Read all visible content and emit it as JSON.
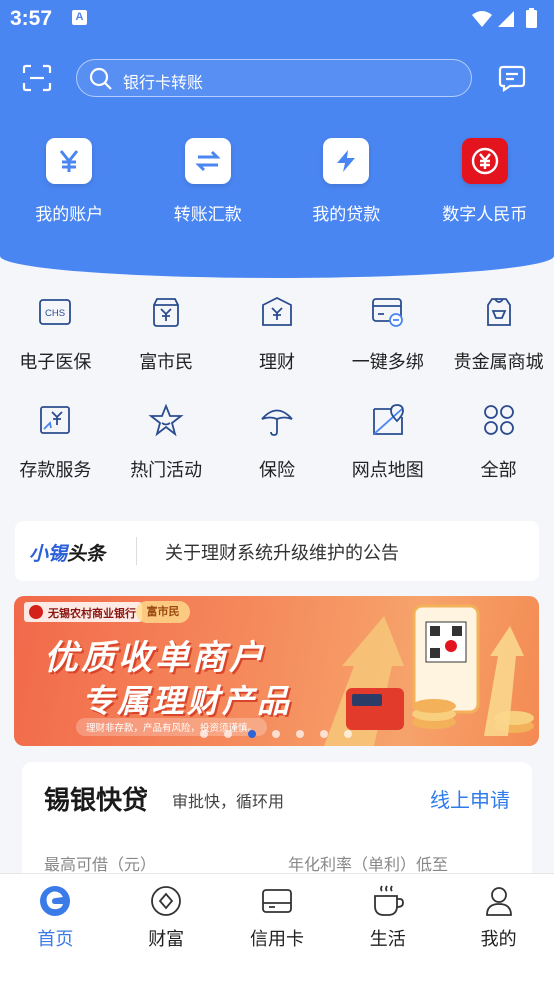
{
  "status_bar": {
    "time": "3:57",
    "notification_badge": "A"
  },
  "search": {
    "placeholder": "银行卡转账"
  },
  "quick_actions": [
    {
      "label": "我的账户",
      "icon": "yen-icon"
    },
    {
      "label": "转账汇款",
      "icon": "transfer-arrows-icon"
    },
    {
      "label": "我的贷款",
      "icon": "lightning-icon"
    },
    {
      "label": "数字人民币",
      "icon": "digital-rmb-icon"
    }
  ],
  "services": [
    {
      "label": "电子医保",
      "icon": "medical-insurance-icon",
      "icon_text": "CHS"
    },
    {
      "label": "富市民",
      "icon": "wallet-yen-icon"
    },
    {
      "label": "理财",
      "icon": "wealth-box-icon"
    },
    {
      "label": "一键多绑",
      "icon": "card-link-icon"
    },
    {
      "label": "贵金属商城",
      "icon": "gold-bag-icon"
    },
    {
      "label": "存款服务",
      "icon": "deposit-icon"
    },
    {
      "label": "热门活动",
      "icon": "star-icon"
    },
    {
      "label": "保险",
      "icon": "umbrella-icon"
    },
    {
      "label": "网点地图",
      "icon": "map-pin-icon"
    },
    {
      "label": "全部",
      "icon": "grid-circles-icon"
    }
  ],
  "headline": {
    "brand_part1": "小锡",
    "brand_part2": "头条",
    "text": "关于理财系统升级维护的公告"
  },
  "banner": {
    "bank_name": "无锡农村商业银行",
    "partner_badge": "富市民",
    "headline1": "优质收单商户",
    "headline2": "专属理财产品",
    "disclaimer": "理财非存款，产品有风险，投资须谨慎。",
    "slide_count": 7,
    "active_slide": 3
  },
  "loan_card": {
    "title": "锡银快贷",
    "subtitle": "审批快，循环用",
    "apply_label": "线上申请",
    "max_label": "最高可借（元）",
    "rate_label": "年化利率（单利）低至"
  },
  "tabs": [
    {
      "label": "首页",
      "icon": "home-logo-icon",
      "active": true
    },
    {
      "label": "财富",
      "icon": "wealth-icon",
      "active": false
    },
    {
      "label": "信用卡",
      "icon": "credit-card-icon",
      "active": false
    },
    {
      "label": "生活",
      "icon": "coffee-cup-icon",
      "active": false
    },
    {
      "label": "我的",
      "icon": "user-icon",
      "active": false
    }
  ],
  "colors": {
    "primary": "#4a86f2",
    "accent_blue": "#2f7bea",
    "digital_rmb_red": "#e4141f"
  }
}
